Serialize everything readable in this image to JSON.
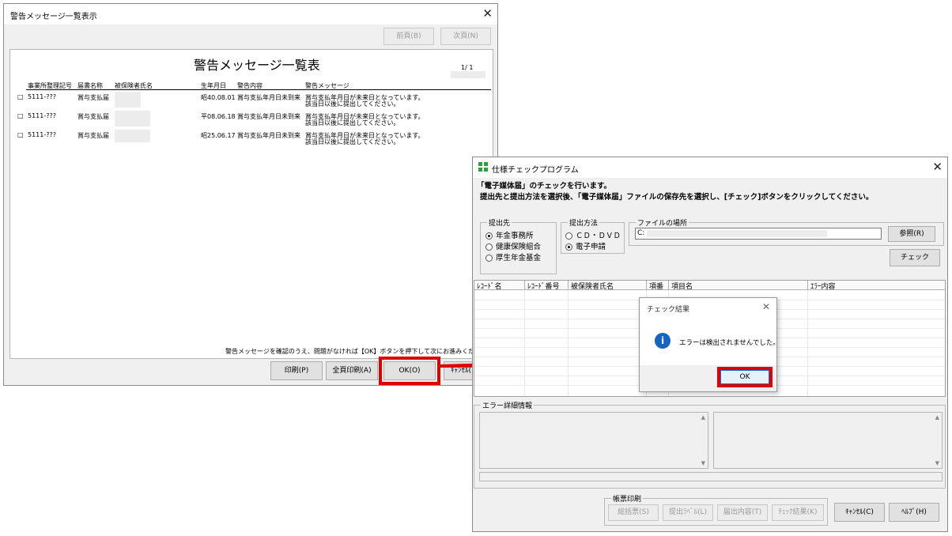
{
  "warning_window": {
    "title": "警告メッセージ一覧表示",
    "prev_button": "前頁(B)",
    "next_button": "次頁(N)",
    "report_title": "警告メッセージ一覧表",
    "page_indicator": "1/ 1",
    "columns": [
      "事業所整理記号",
      "届書名称",
      "被保険者氏名",
      "生年月日",
      "警告内容",
      "警告メッセージ"
    ],
    "rows": [
      {
        "checkbox": "□",
        "office": "5111-???",
        "form": "賞与支払届",
        "birth": "昭40.08.01",
        "content": "賞与支払年月日未到来",
        "msg1": "賞与支払年月日が未来日となっています。",
        "msg2": "該当日以後に提出してください。"
      },
      {
        "checkbox": "□",
        "office": "5111-???",
        "form": "賞与支払届",
        "birth": "平08.06.18",
        "content": "賞与支払年月日未到来",
        "msg1": "賞与支払年月日が未来日となっています。",
        "msg2": "該当日以後に提出してください。"
      },
      {
        "checkbox": "□",
        "office": "5111-???",
        "form": "賞与支払届",
        "birth": "昭25.06.17",
        "content": "賞与支払年月日未到来",
        "msg1": "賞与支払年月日が未来日となっています。",
        "msg2": "該当日以後に提出してください。"
      }
    ],
    "footer_note": "警告メッセージを確認のうえ、問題がなければ【OK】ボタンを押下して次にお進みくださ",
    "print_button": "印刷(P)",
    "print_all_button": "全頁印刷(A)",
    "ok_button": "OK(O)",
    "cancel_button": "ｷｬﾝｾﾙ("
  },
  "check_window": {
    "title": "仕様チェックプログラム",
    "heading": "「電子媒体届」のチェックを行います。",
    "instruction": "提出先と提出方法を選択後、「電子媒体届」ファイルの保存先を選択し、[チェック]ボタンをクリックしてください。",
    "dest_group": {
      "label": "提出先",
      "options": [
        "年金事務所",
        "健康保険組合",
        "厚生年金基金"
      ],
      "selected": 0
    },
    "method_group": {
      "label": "提出方法",
      "options": [
        "ＣＤ・ＤＶＤ",
        "電子申請"
      ],
      "selected": 1
    },
    "file_group": {
      "label": "ファイルの場所",
      "path": "C:",
      "browse_button": "参照(R)"
    },
    "check_button": "チェック",
    "grid_columns": [
      "ﾚｺｰﾄﾞ名",
      "ﾚｺｰﾄﾞ番号",
      "被保険者氏名",
      "項番",
      "項目名",
      "ｴﾗｰ内容"
    ],
    "error_detail_label": "エラー詳細情報",
    "print_group_label": "帳票印刷",
    "print_buttons": [
      "総括票(S)",
      "提出ﾗﾍﾞﾙ(L)",
      "届出内容(T)",
      "ﾁｪｯｸ結果(K)"
    ],
    "cancel_button": "ｷｬﾝｾﾙ(C)",
    "help_button": "ﾍﾙﾌﾟ(H)"
  },
  "result_dialog": {
    "title": "チェック結果",
    "message": "エラーは検出されませんでした。",
    "ok_button": "OK"
  },
  "colors": {
    "highlight": "#e10000",
    "info_icon": "#1565c0",
    "app_icon": "#2e9e3e"
  }
}
